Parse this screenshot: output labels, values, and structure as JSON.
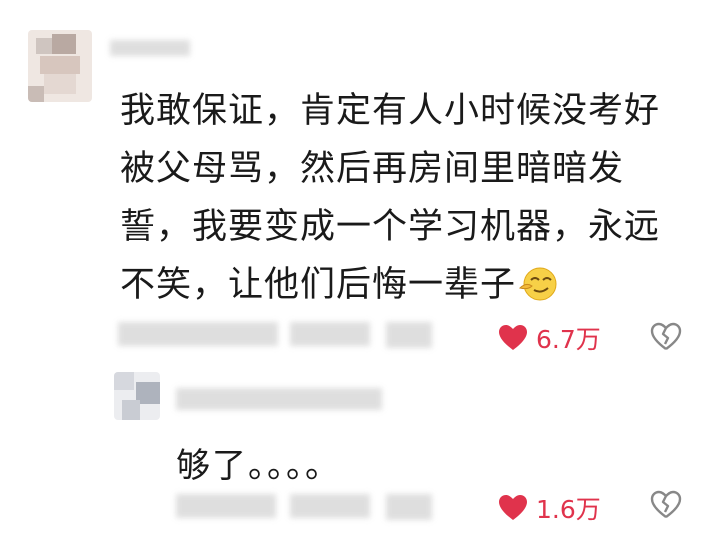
{
  "comment": {
    "text": "我敢保证，肯定有人小时候没考好被父母骂，然后再房间里暗暗发誓，我要变成一个学习机器，永远不笑，让他们后悔一辈子",
    "emoji": "smirk-emoji",
    "likes": "6.7万"
  },
  "reply": {
    "text": "够了。。。。",
    "likes": "1.6万"
  },
  "colors": {
    "like": "#e0334c",
    "blur": "#d9d9d9",
    "icon_gray": "#888888"
  }
}
